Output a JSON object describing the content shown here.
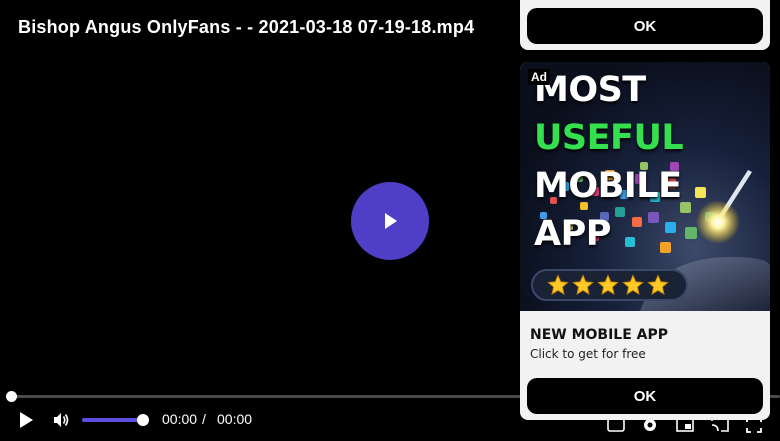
{
  "player": {
    "title": "Bishop Angus OnlyFans - - 2021-03-18 07-19-18.mp4",
    "current_time": "00:00",
    "time_separator": "/",
    "duration": "00:00",
    "progress_fraction": 0.0,
    "volume_fraction": 1.0,
    "accent_color": "#4f3fc7",
    "icons": [
      "play-icon",
      "volume-icon",
      "subtitles-icon",
      "settings-icon",
      "pip-icon",
      "cast-icon",
      "fullscreen-icon"
    ]
  },
  "top_ad": {
    "ok_label": "OK"
  },
  "ad": {
    "badge": "Ad",
    "headline_line1_a": "MOST ",
    "headline_line1_b": "USEFUL",
    "headline_line2": "MOBILE APP",
    "rating_stars": 5,
    "title": "NEW MOBILE APP",
    "subtitle": "Click to get for free",
    "ok_label": "OK"
  }
}
